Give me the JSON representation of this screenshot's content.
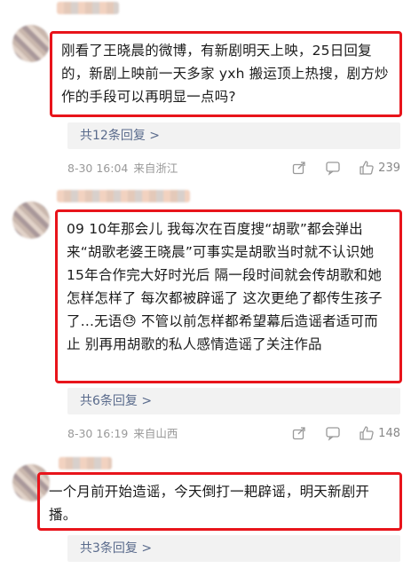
{
  "comments": [
    {
      "text": "刚看了王晓晨的微博，有新剧明天上映，25日回复的，新剧上映前一天多家 yxh 搬运顶上热搜，剧方炒作的手段可以再明显一点吗?",
      "replies": "共12条回复 >",
      "date": "8-30 16:04",
      "location": "来自浙江",
      "likes": "239"
    },
    {
      "text": "09  10年那会儿 我每次在百度搜“胡歌”都会弹出来“胡歌老婆王晓晨”可事实是胡歌当时就不认识她  15年合作完大好时光后  隔一段时间就会传胡歌和她怎样怎样了  每次都被辟谣了  这次更绝了都传生孩子了...无语😓  不管以前怎样都希望幕后造谣者适可而止  别再用胡歌的私人感情造谣了关注作品",
      "replies": "共6条回复 >",
      "date": "8-30 16:19",
      "location": "来自山西",
      "likes": "148"
    },
    {
      "text": "一个月前开始造谣，今天倒打一耙辟谣，明天新剧开播。",
      "replies": "共3条回复 >"
    }
  ]
}
